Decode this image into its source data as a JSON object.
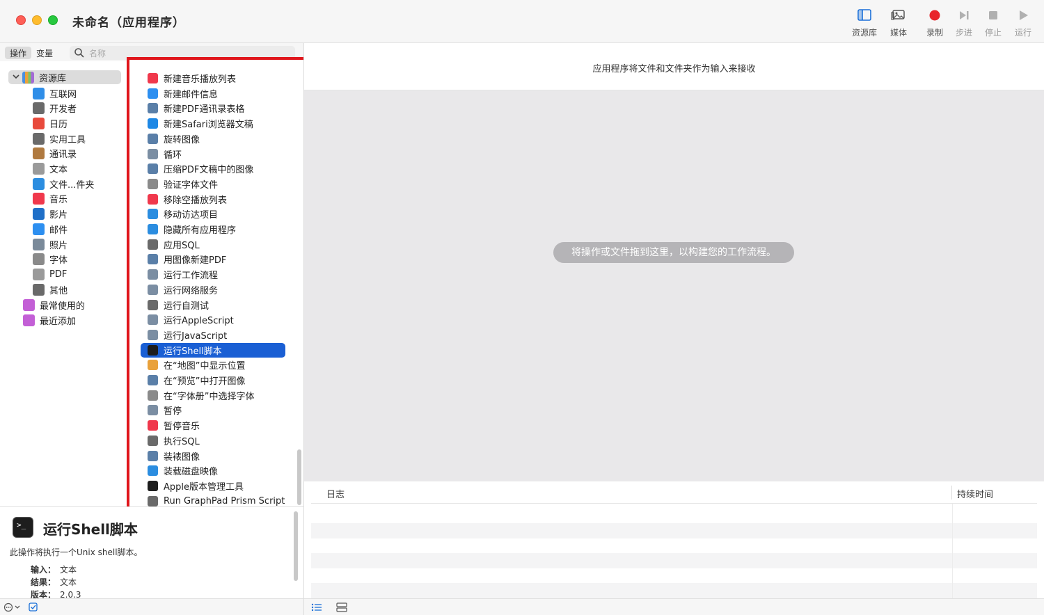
{
  "window": {
    "title": "未命名（应用程序）"
  },
  "toolbar": {
    "library": "资源库",
    "media": "媒体",
    "record": "录制",
    "step": "步进",
    "stop": "停止",
    "run": "运行"
  },
  "sidebar_tabs": {
    "actions": "操作",
    "variables": "变量"
  },
  "search": {
    "placeholder": "名称"
  },
  "library": {
    "root": "资源库",
    "items": [
      {
        "label": "互联网",
        "icon": "globe-icon",
        "color": "#2f8ee8"
      },
      {
        "label": "开发者",
        "icon": "tools-icon",
        "color": "#6a6a6a"
      },
      {
        "label": "日历",
        "icon": "calendar-icon",
        "color": "#e84a3c"
      },
      {
        "label": "实用工具",
        "icon": "tools-icon",
        "color": "#6a6a6a"
      },
      {
        "label": "通讯录",
        "icon": "contacts-icon",
        "color": "#b07a40"
      },
      {
        "label": "文本",
        "icon": "text-icon",
        "color": "#9a9a9a"
      },
      {
        "label": "文件...件夹",
        "icon": "finder-icon",
        "color": "#2b8de0"
      },
      {
        "label": "音乐",
        "icon": "music-icon",
        "color": "#f0384c"
      },
      {
        "label": "影片",
        "icon": "movie-icon",
        "color": "#1f6fc8"
      },
      {
        "label": "邮件",
        "icon": "mail-icon",
        "color": "#2d8ff0"
      },
      {
        "label": "照片",
        "icon": "photo-icon",
        "color": "#7a8a9a"
      },
      {
        "label": "字体",
        "icon": "font-icon",
        "color": "#8a8a8a"
      },
      {
        "label": "PDF",
        "icon": "pdf-icon",
        "color": "#9a9a9a"
      },
      {
        "label": "其他",
        "icon": "tools-icon",
        "color": "#6a6a6a"
      }
    ],
    "smart": [
      {
        "label": "最常使用的",
        "icon": "smart-folder-icon",
        "color": "#c35fd6"
      },
      {
        "label": "最近添加",
        "icon": "smart-folder-icon",
        "color": "#c35fd6"
      }
    ]
  },
  "actions": [
    {
      "label": "新建音乐播放列表",
      "icon": "music-icon",
      "color": "#f0384c"
    },
    {
      "label": "新建邮件信息",
      "icon": "mail-icon",
      "color": "#2d8ff0"
    },
    {
      "label": "新建PDF通讯录表格",
      "icon": "preview-icon",
      "color": "#5a7fa8"
    },
    {
      "label": "新建Safari浏览器文稿",
      "icon": "safari-icon",
      "color": "#1e88e5"
    },
    {
      "label": "旋转图像",
      "icon": "preview-icon",
      "color": "#5a7fa8"
    },
    {
      "label": "循环",
      "icon": "automator-icon",
      "color": "#7b8ea3"
    },
    {
      "label": "压缩PDF文稿中的图像",
      "icon": "preview-icon",
      "color": "#5a7fa8"
    },
    {
      "label": "验证字体文件",
      "icon": "font-icon",
      "color": "#8a8a8a"
    },
    {
      "label": "移除空播放列表",
      "icon": "music-icon",
      "color": "#f0384c"
    },
    {
      "label": "移动访达项目",
      "icon": "finder-icon",
      "color": "#2b8de0"
    },
    {
      "label": "隐藏所有应用程序",
      "icon": "finder-icon",
      "color": "#2b8de0"
    },
    {
      "label": "应用SQL",
      "icon": "tools-icon",
      "color": "#6a6a6a"
    },
    {
      "label": "用图像新建PDF",
      "icon": "preview-icon",
      "color": "#5a7fa8"
    },
    {
      "label": "运行工作流程",
      "icon": "automator-icon",
      "color": "#7b8ea3"
    },
    {
      "label": "运行网络服务",
      "icon": "automator-icon",
      "color": "#7b8ea3"
    },
    {
      "label": "运行自测试",
      "icon": "tools-icon",
      "color": "#6a6a6a"
    },
    {
      "label": "运行AppleScript",
      "icon": "script-icon",
      "color": "#7b8ea3"
    },
    {
      "label": "运行JavaScript",
      "icon": "script-icon",
      "color": "#7b8ea3"
    },
    {
      "label": "运行Shell脚本",
      "icon": "terminal-icon",
      "color": "#1d1d1d",
      "selected": true
    },
    {
      "label": "在“地图”中显示位置",
      "icon": "maps-icon",
      "color": "#e9a13b"
    },
    {
      "label": "在“预览”中打开图像",
      "icon": "preview-icon",
      "color": "#5a7fa8"
    },
    {
      "label": "在“字体册”中选择字体",
      "icon": "font-icon",
      "color": "#8a8a8a"
    },
    {
      "label": "暂停",
      "icon": "automator-icon",
      "color": "#7b8ea3"
    },
    {
      "label": "暂停音乐",
      "icon": "music-icon",
      "color": "#f0384c"
    },
    {
      "label": "执行SQL",
      "icon": "tools-icon",
      "color": "#6a6a6a"
    },
    {
      "label": "装裱图像",
      "icon": "preview-icon",
      "color": "#5a7fa8"
    },
    {
      "label": "装载磁盘映像",
      "icon": "finder-icon",
      "color": "#2b8de0"
    },
    {
      "label": "Apple版本管理工具",
      "icon": "terminal-icon",
      "color": "#1d1d1d"
    },
    {
      "label": "Run GraphPad Prism Script",
      "icon": "tools-icon",
      "color": "#6a6a6a"
    }
  ],
  "description": {
    "title": "运行Shell脚本",
    "text": "此操作将执行一个Unix shell脚本。",
    "input_label": "输入：",
    "input_value": "文本",
    "result_label": "结果：",
    "result_value": "文本",
    "version_label": "版本：",
    "version_value": "2.0.3"
  },
  "workflow": {
    "header_info": "应用程序将文件和文件夹作为输入来接收",
    "drop_hint": "将操作或文件拖到这里，以构建您的工作流程。"
  },
  "log": {
    "col_log": "日志",
    "col_duration": "持续时间"
  },
  "colors": {
    "selection": "#1a5fd4",
    "highlight_border": "#e0161c",
    "record": "#e8242a"
  }
}
